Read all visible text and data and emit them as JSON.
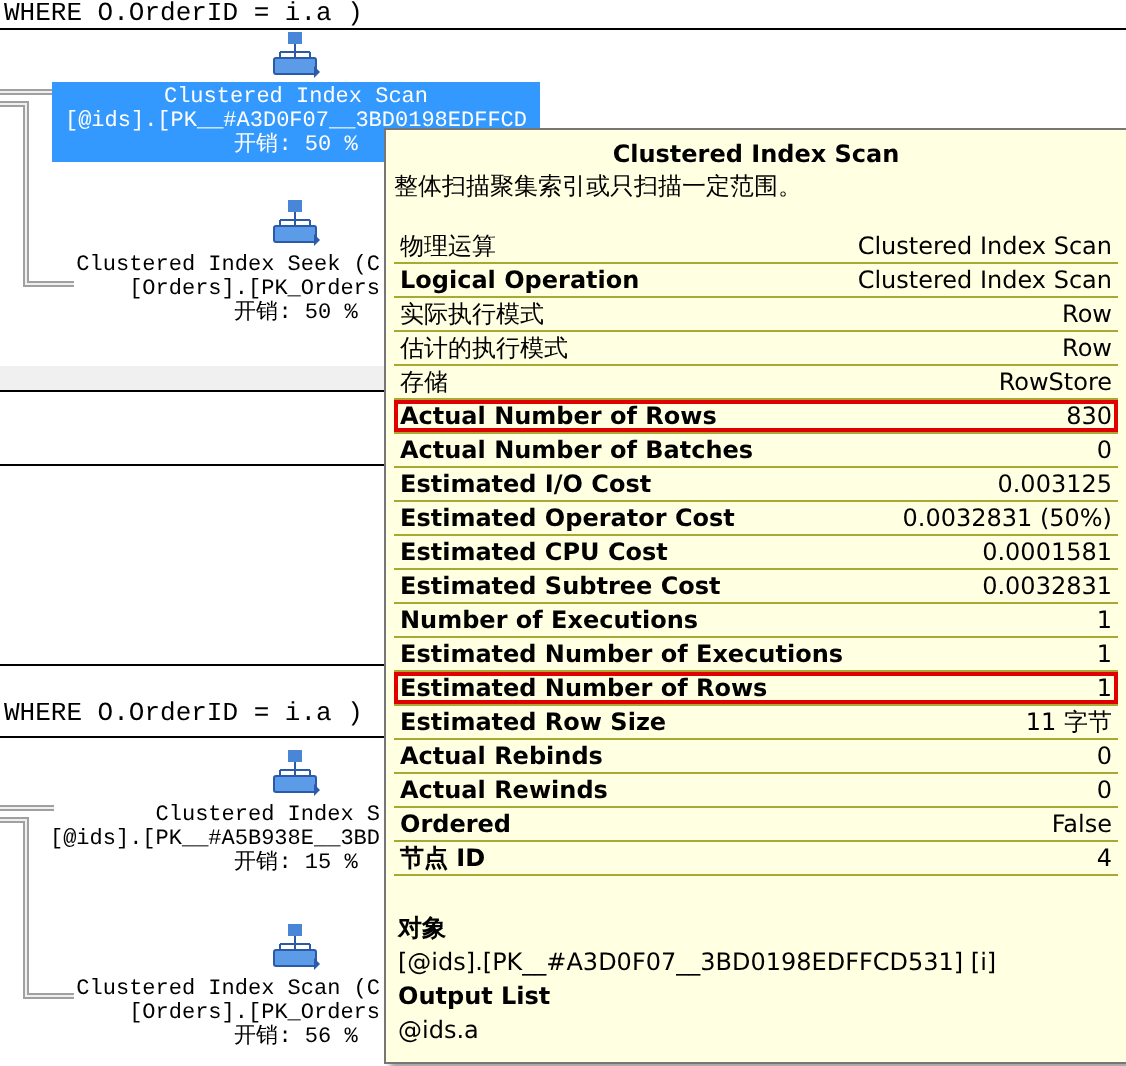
{
  "plans": [
    {
      "query": "WHERE O.OrderID = i.a )",
      "nodes": [
        {
          "selected": true,
          "lines": [
            "Clustered Index Scan",
            "[@ids].[PK__#A3D0F07__3BD0198EDFFCD",
            "开销: 50 %"
          ]
        },
        {
          "selected": false,
          "lines": [
            "Clustered Index Seek (C",
            "[Orders].[PK_Orders",
            "开销: 50 %"
          ]
        }
      ]
    },
    {
      "query": "WHERE O.OrderID = i.a )",
      "nodes": [
        {
          "selected": false,
          "lines": [
            "Clustered Index S",
            "[@ids].[PK__#A5B938E__3BD",
            "开销: 15 %"
          ]
        },
        {
          "selected": false,
          "lines": [
            "Clustered Index Scan (C",
            "[Orders].[PK_Orders",
            "开销: 56 %"
          ]
        }
      ]
    }
  ],
  "tooltip": {
    "title": "Clustered Index Scan",
    "description": "整体扫描聚集索引或只扫描一定范围。",
    "properties": [
      {
        "label": "物理运算",
        "value": "Clustered Index Scan",
        "bold": false,
        "highlighted": false
      },
      {
        "label": "Logical Operation",
        "value": "Clustered Index Scan",
        "bold": true,
        "highlighted": false
      },
      {
        "label": "实际执行模式",
        "value": "Row",
        "bold": false,
        "highlighted": false
      },
      {
        "label": "估计的执行模式",
        "value": "Row",
        "bold": false,
        "highlighted": false
      },
      {
        "label": "存储",
        "value": "RowStore",
        "bold": false,
        "highlighted": false
      },
      {
        "label": "Actual Number of Rows",
        "value": "830",
        "bold": true,
        "highlighted": true
      },
      {
        "label": "Actual Number of Batches",
        "value": "0",
        "bold": true,
        "highlighted": false
      },
      {
        "label": "Estimated I/O Cost",
        "value": "0.003125",
        "bold": true,
        "highlighted": false
      },
      {
        "label": "Estimated Operator Cost",
        "value": "0.0032831 (50%)",
        "bold": true,
        "highlighted": false
      },
      {
        "label": "Estimated CPU Cost",
        "value": "0.0001581",
        "bold": true,
        "highlighted": false
      },
      {
        "label": "Estimated Subtree Cost",
        "value": "0.0032831",
        "bold": true,
        "highlighted": false
      },
      {
        "label": "Number of Executions",
        "value": "1",
        "bold": true,
        "highlighted": false
      },
      {
        "label": "Estimated Number of Executions",
        "value": "1",
        "bold": true,
        "highlighted": false
      },
      {
        "label": "Estimated Number of Rows",
        "value": "1",
        "bold": true,
        "highlighted": true
      },
      {
        "label": "Estimated Row Size",
        "value": "11 字节",
        "bold": true,
        "highlighted": false
      },
      {
        "label": "Actual Rebinds",
        "value": "0",
        "bold": true,
        "highlighted": false
      },
      {
        "label": "Actual Rewinds",
        "value": "0",
        "bold": true,
        "highlighted": false
      },
      {
        "label": "Ordered",
        "value": "False",
        "bold": true,
        "highlighted": false
      },
      {
        "label": "节点 ID",
        "value": "4",
        "bold": true,
        "highlighted": false
      }
    ],
    "sections": [
      {
        "heading": "对象",
        "value": "[@ids].[PK__#A3D0F07__3BD0198EDFFCD531] [i]"
      },
      {
        "heading": "Output List",
        "value": "@ids.a"
      }
    ]
  }
}
